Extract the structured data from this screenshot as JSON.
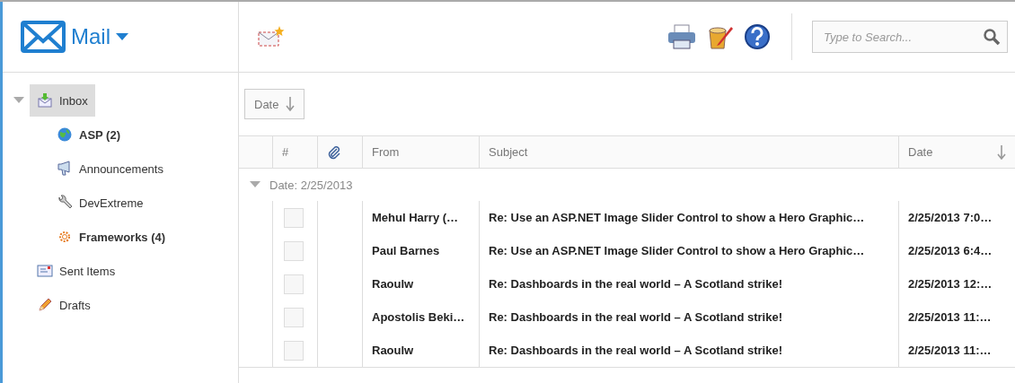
{
  "app": {
    "title": "Mail"
  },
  "folders": [
    {
      "label": "Inbox",
      "kind": "inbox",
      "selected": true,
      "expanded": true,
      "unread": false,
      "children": [
        {
          "label": "ASP (2)",
          "kind": "globe",
          "selected": false,
          "unread": true
        },
        {
          "label": "Announcements",
          "kind": "megaphone",
          "selected": false,
          "unread": false
        },
        {
          "label": "DevExtreme",
          "kind": "wrench",
          "selected": false,
          "unread": false
        },
        {
          "label": "Frameworks (4)",
          "kind": "gear",
          "selected": false,
          "unread": true
        }
      ]
    },
    {
      "label": "Sent Items",
      "kind": "sent",
      "selected": false,
      "unread": false
    },
    {
      "label": "Drafts",
      "kind": "pencil",
      "selected": false,
      "unread": false
    }
  ],
  "search": {
    "placeholder": "Type to Search..."
  },
  "group_panel": {
    "label": "Date",
    "sort_descending": true
  },
  "table": {
    "columns": [
      {
        "label": "#",
        "kind": "text"
      },
      {
        "kind": "attach"
      },
      {
        "label": "From",
        "kind": "text"
      },
      {
        "label": "Subject",
        "kind": "text"
      },
      {
        "label": "Date",
        "kind": "sorted"
      }
    ],
    "groups": [
      {
        "label": "Date: 2/25/2013",
        "expanded": true,
        "rows": [
          {
            "checked": false,
            "unread": true,
            "from": "Mehul Harry (…",
            "subject": "Re: Use an ASP.NET Image Slider Control to show a Hero Graphic…",
            "date": "2/25/2013 7:0…"
          },
          {
            "checked": false,
            "unread": true,
            "from": "Paul Barnes",
            "subject": "Re: Use an ASP.NET Image Slider Control to show a Hero Graphic…",
            "date": "2/25/2013 6:4…"
          },
          {
            "checked": false,
            "unread": true,
            "from": "Raoulw",
            "subject": "Re: Dashboards in the real world – A Scotland strike!",
            "date": "2/25/2013 12:…"
          },
          {
            "checked": false,
            "unread": true,
            "from": "Apostolis Beki…",
            "subject": "Re: Dashboards in the real world – A Scotland strike!",
            "date": "2/25/2013 11:…"
          },
          {
            "checked": false,
            "unread": true,
            "from": "Raoulw",
            "subject": "Re: Dashboards in the real world – A Scotland strike!",
            "date": "2/25/2013 11:…"
          }
        ]
      }
    ]
  }
}
